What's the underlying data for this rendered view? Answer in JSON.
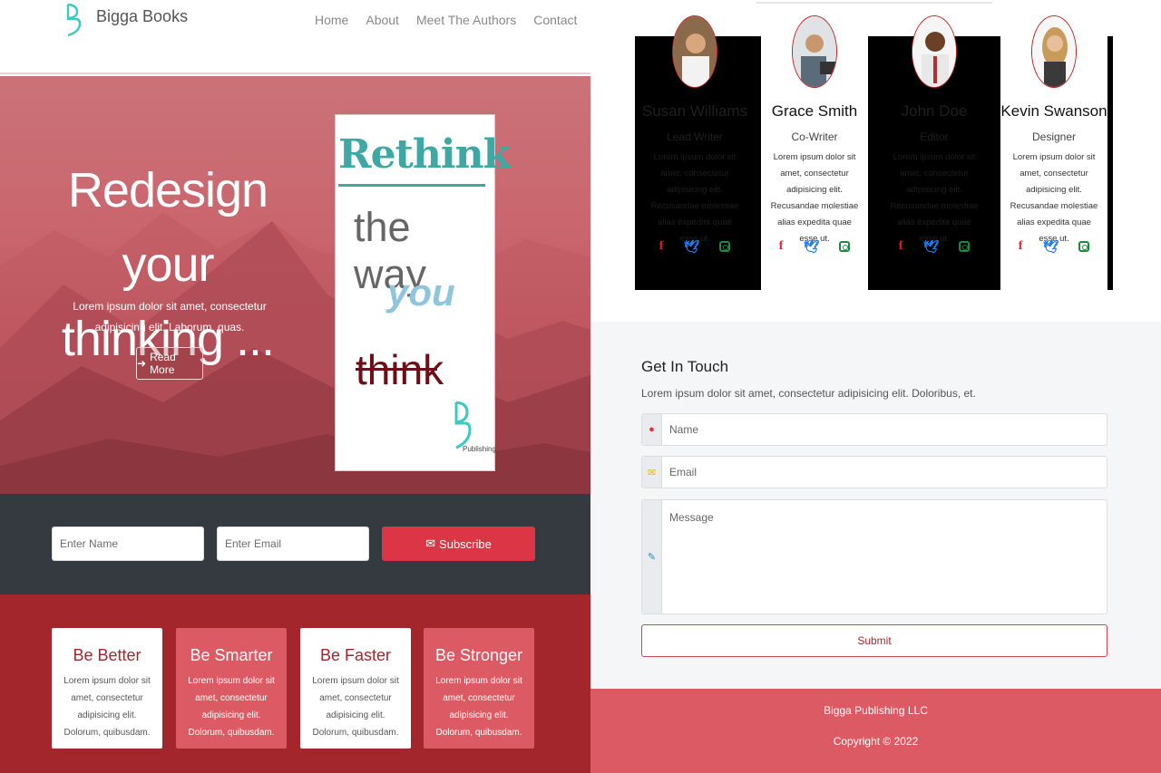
{
  "nav": {
    "brand": "Bigga Books",
    "links": [
      "Home",
      "About",
      "Meet The Authors",
      "Contact"
    ]
  },
  "hero": {
    "title_line1": "Redesign your",
    "title_line2": "thinking ...",
    "subtitle": "Lorem ipsum dolor sit amet, consectetur adipisicing elit. Laborum, quas.",
    "button": "Read More",
    "book": {
      "line1": "Rethink",
      "line2": "the way",
      "line3": "you",
      "line4": "think",
      "publisher": "Publishing"
    }
  },
  "subscribe": {
    "name_placeholder": "Enter Name",
    "email_placeholder": "Enter Email",
    "button": "Subscribe"
  },
  "features": [
    {
      "title": "Be Better",
      "text": "Lorem ipsum dolor sit amet, consectetur adipisicing elit. Dolorum, quibusdam.",
      "style": "white"
    },
    {
      "title": "Be Smarter",
      "text": "Lorem ipsum dolor sit amet, consectetur adipisicing elit. Dolorum, quibusdam.",
      "style": "pink"
    },
    {
      "title": "Be Faster",
      "text": "Lorem ipsum dolor sit amet, consectetur adipisicing elit. Dolorum, quibusdam.",
      "style": "white"
    },
    {
      "title": "Be Stronger",
      "text": "Lorem ipsum dolor sit amet, consectetur adipisicing elit. Dolorum, quibusdam.",
      "style": "pink"
    }
  ],
  "team": [
    {
      "name": "Susan Williams",
      "role": "Lead Writer",
      "bio": "Lorem ipsum dolor sit amet, consectetur adipisicing elit. Recusandae molestiae alias expedita quae esse ut.",
      "theme": "dark"
    },
    {
      "name": "Grace Smith",
      "role": "Co-Writer",
      "bio": "Lorem ipsum dolor sit amet, consectetur adipisicing elit. Recusandae molestiae alias expedita quae esse ut.",
      "theme": "light"
    },
    {
      "name": "John Doe",
      "role": "Editor",
      "bio": "Lorem ipsum dolor sit amet, consectetur adipisicing elit. Recusandae molestiae alias expedita quae esse ut.",
      "theme": "dark"
    },
    {
      "name": "Kevin Swanson",
      "role": "Designer",
      "bio": "Lorem ipsum dolor sit amet, consectetur adipisicing elit. Recusandae molestiae alias expedita quae esse ut.",
      "theme": "light"
    }
  ],
  "social_icons": [
    "facebook-icon",
    "twitter-icon",
    "instagram-icon"
  ],
  "contact": {
    "title": "Get In Touch",
    "subtitle": "Lorem ipsum dolor sit amet, consectetur adipisicing elit. Doloribus, et.",
    "name_placeholder": "Name",
    "email_placeholder": "Email",
    "message_placeholder": "Message",
    "submit": "Submit"
  },
  "footer": {
    "company": "Bigga Publishing LLC",
    "copyright": "Copyright © 2022"
  },
  "colors": {
    "primary_red": "#dc3545",
    "dark_red": "#a3262d",
    "pink": "#dc5a63",
    "teal": "#3fa8a4",
    "dark": "#353a40"
  }
}
